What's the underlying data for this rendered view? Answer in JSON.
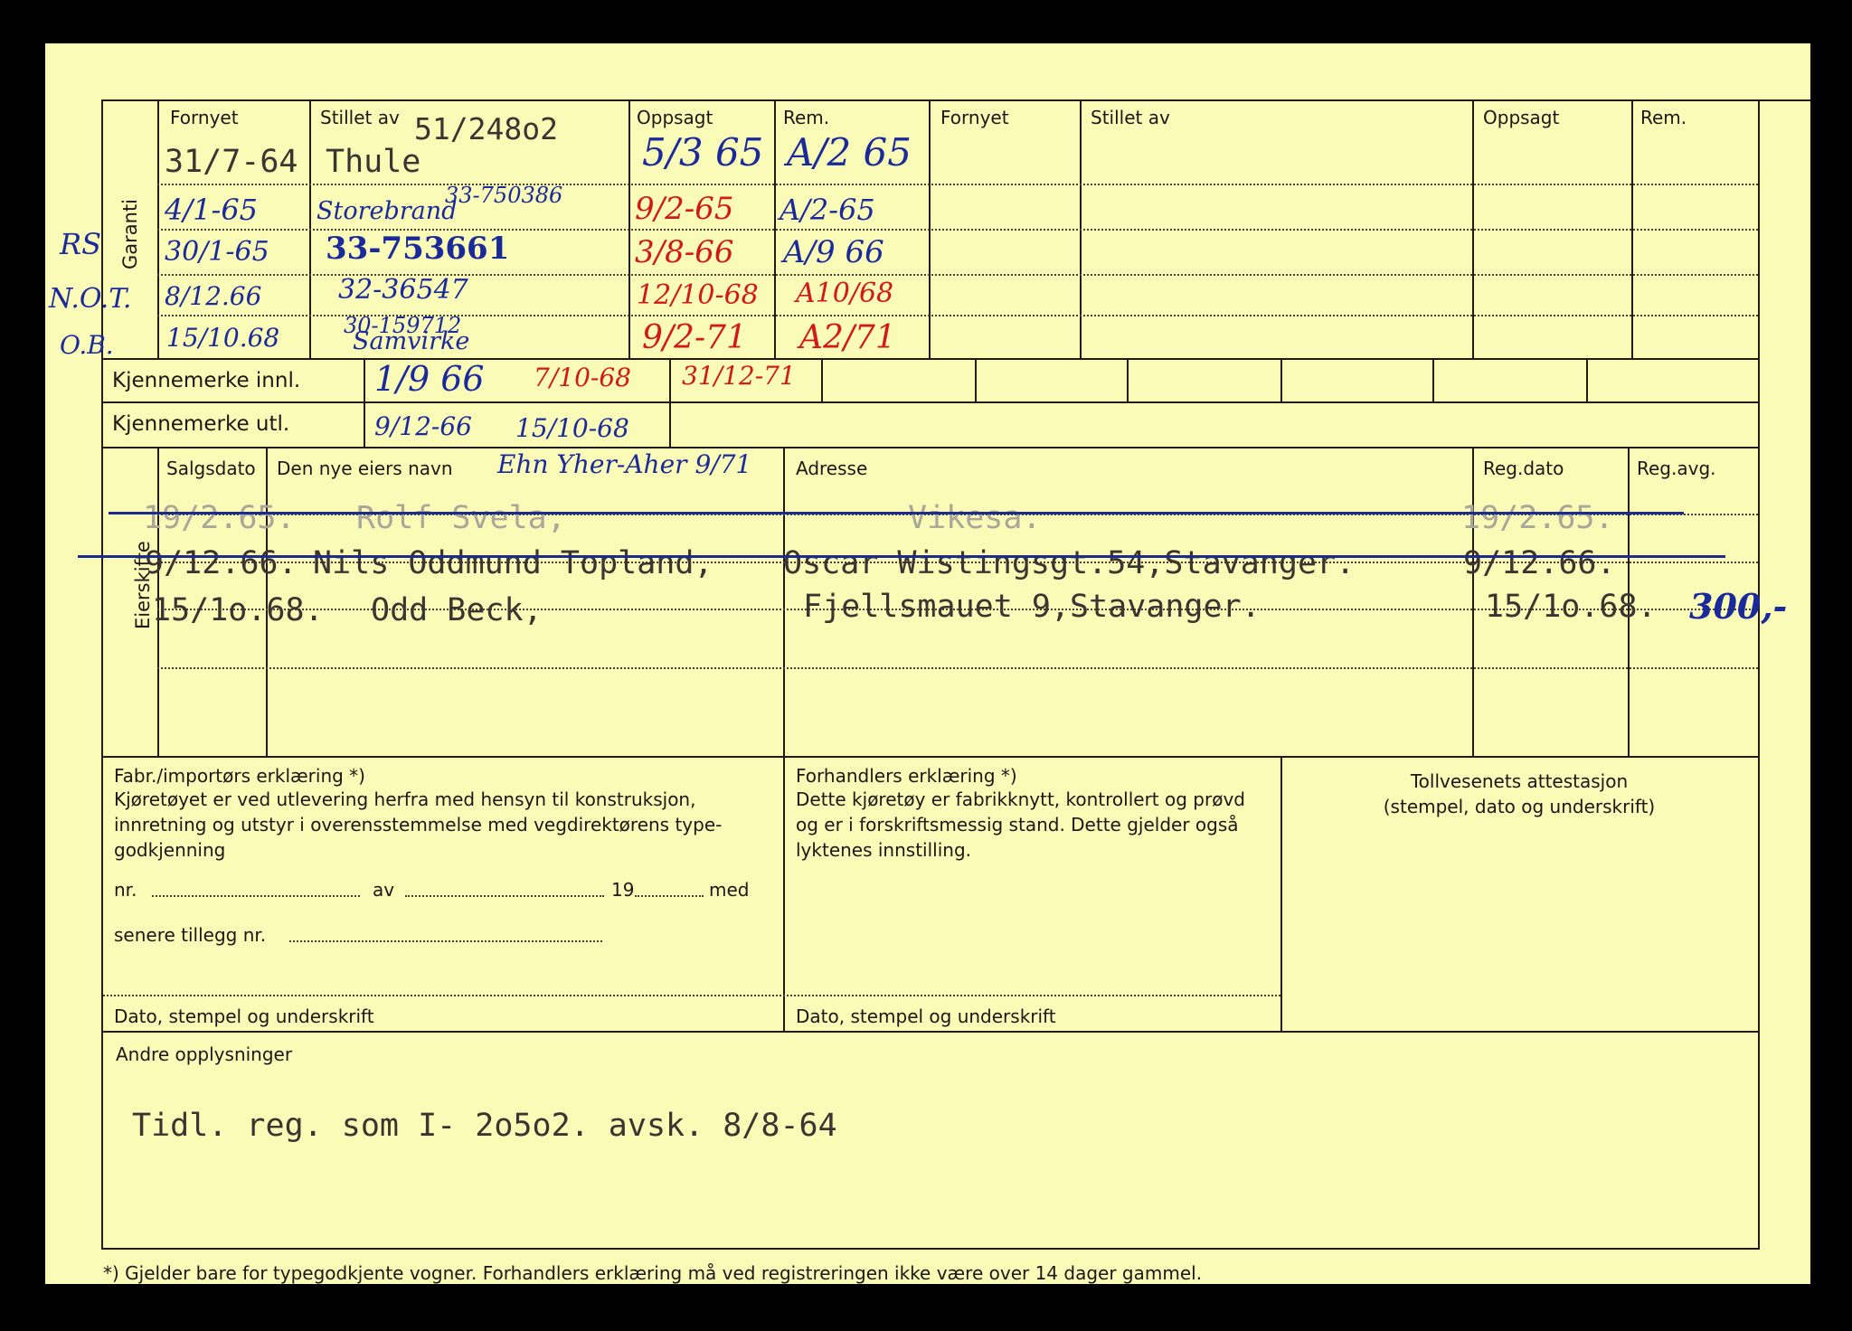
{
  "header": {
    "left": {
      "fornyet": "Fornyet",
      "stillet_av": "Stillet av",
      "stillet_av_value": "51/248o2",
      "oppsagt": "Oppsagt",
      "rem": "Rem."
    },
    "right": {
      "fornyet": "Fornyet",
      "stillet_av": "Stillet av",
      "oppsagt": "Oppsagt",
      "rem": "Rem."
    },
    "garanti": "Garanti"
  },
  "margin_notes": [
    "RS",
    "N.O.T.",
    "O.B."
  ],
  "garanti_rows": [
    {
      "fornyet": "31/7-64",
      "stillet_av": "Thule",
      "oppsagt": "5/3 65",
      "rem": "A/2 65"
    },
    {
      "fornyet": "4/1-65",
      "stillet_av": "Storebrand",
      "stillet_av_number": "33-750386",
      "oppsagt": "9/2-65",
      "rem": "A/2-65"
    },
    {
      "fornyet": "30/1-65",
      "stillet_av": "33-753661",
      "oppsagt": "3/8-66",
      "rem": "A/9 66"
    },
    {
      "fornyet": "8/12.66",
      "stillet_av": "32-36547",
      "oppsagt": "12/10-68",
      "rem": "A10/68"
    },
    {
      "fornyet": "15/10.68",
      "stillet_av": "Samvirke",
      "stillet_av_number": "30-159712",
      "oppsagt": "9/2-71",
      "rem": "A2/71"
    }
  ],
  "kjennemerke": {
    "innl_label": "Kjennemerke innl.",
    "utl_label": "Kjennemerke utl.",
    "innl": [
      "1/9 66",
      "7/10-68",
      "31/12-71"
    ],
    "utl": [
      "9/12-66",
      "15/10-68"
    ]
  },
  "eierskifte": {
    "label": "Eierskifte",
    "headers": {
      "salgsdato": "Salgsdato",
      "navn": "Den nye eiers navn",
      "navn_note": "Ehn Yher-Aher 9/71",
      "adresse": "Adresse",
      "regdato": "Reg.dato",
      "regavg": "Reg.avg."
    },
    "rows": [
      {
        "salgsdato": "19/2.65.",
        "navn": "Rolf Svela,",
        "adresse": "Vikesa.",
        "regdato": "19/2.65.",
        "regavg": "",
        "struck": true
      },
      {
        "salgsdato": "9/12.66.",
        "navn": "Nils Oddmund Topland,",
        "adresse": "Oscar Wistingsgt.54,Stavanger.",
        "regdato": "9/12.66.",
        "regavg": "",
        "struck": true
      },
      {
        "salgsdato": "15/1o.68.",
        "navn": "Odd Beck,",
        "adresse": "Fjellsmauet 9,Stavanger.",
        "regdato": "15/1o.68.",
        "regavg": "300,-",
        "struck": false
      }
    ]
  },
  "fabr": {
    "title": "Fabr./importørs erklæring *)",
    "text": "Kjøretøyet er ved utlevering herfra med hensyn til konstruksjon, innretning og utstyr i overensstemmelse med vegdirektørens type-godkjenning",
    "nr": "nr.",
    "av": "av",
    "year": "19",
    "med": "med",
    "senere": "senere tillegg nr.",
    "dato": "Dato, stempel og underskrift"
  },
  "forhandler": {
    "title": "Forhandlers erklæring *)",
    "text": "Dette kjøretøy er fabrikknytt, kontrollert og prøvd og er i forskriftsmessig stand. Dette gjelder også lyktenes innstilling.",
    "dato": "Dato, stempel og underskrift"
  },
  "toll": {
    "title": "Tollvesenets attestasjon",
    "sub": "(stempel, dato og underskrift)"
  },
  "andre": {
    "label": "Andre opplysninger",
    "text": "Tidl. reg. som I- 2o5o2. avsk. 8/8-64"
  },
  "footnote": "*)  Gjelder bare for typegodkjente vogner.  Forhandlers erklæring må ved registreringen ikke være over 14 dager gammel."
}
